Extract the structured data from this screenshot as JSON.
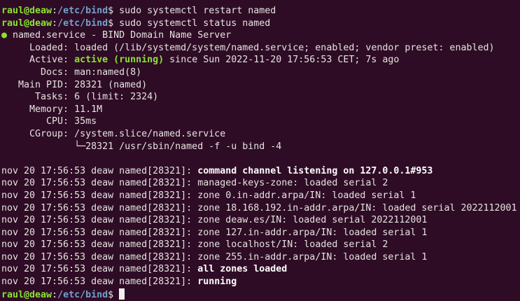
{
  "prompt": {
    "user_host": "raul@deaw",
    "sep": ":",
    "path": "/etc/bind",
    "symbol": "$ "
  },
  "commands": [
    "sudo systemctl restart named",
    "sudo systemctl status named"
  ],
  "status": {
    "dot": "●",
    "header": " named.service - BIND Domain Name Server",
    "loaded": "     Loaded: loaded (/lib/systemd/system/named.service; enabled; vendor preset: enabled)",
    "active_label": "     Active: ",
    "active_state": "active (running)",
    "active_rest": " since Sun 2022-11-20 17:56:53 CET; 7s ago",
    "docs": "       Docs: man:named(8)",
    "main_pid": "   Main PID: 28321 (named)",
    "tasks": "      Tasks: 6 (limit: 2324)",
    "memory": "     Memory: 11.1M",
    "cpu": "        CPU: 35ms",
    "cgroup": "     CGroup: /system.slice/named.service",
    "cgroup_proc": "             └─28321 /usr/sbin/named -f -u bind -4"
  },
  "colors": {
    "background": "#2f0c25",
    "prompt_user": "#8ae234",
    "prompt_path": "#729fcf",
    "active": "#8ae234"
  },
  "log_prefix": "nov 20 17:56:53 deaw named[28321]: ",
  "log": [
    {
      "msg": "command channel listening on 127.0.0.1#953",
      "bold": true
    },
    {
      "msg": "managed-keys-zone: loaded serial 2",
      "bold": false
    },
    {
      "msg": "zone 0.in-addr.arpa/IN: loaded serial 1",
      "bold": false
    },
    {
      "msg": "zone 18.168.192.in-addr.arpa/IN: loaded serial 2022112001",
      "bold": false
    },
    {
      "msg": "zone deaw.es/IN: loaded serial 2022112001",
      "bold": false
    },
    {
      "msg": "zone 127.in-addr.arpa/IN: loaded serial 1",
      "bold": false
    },
    {
      "msg": "zone localhost/IN: loaded serial 2",
      "bold": false
    },
    {
      "msg": "zone 255.in-addr.arpa/IN: loaded serial 1",
      "bold": false
    },
    {
      "msg": "all zones loaded",
      "bold": true
    },
    {
      "msg": "running",
      "bold": true
    }
  ]
}
